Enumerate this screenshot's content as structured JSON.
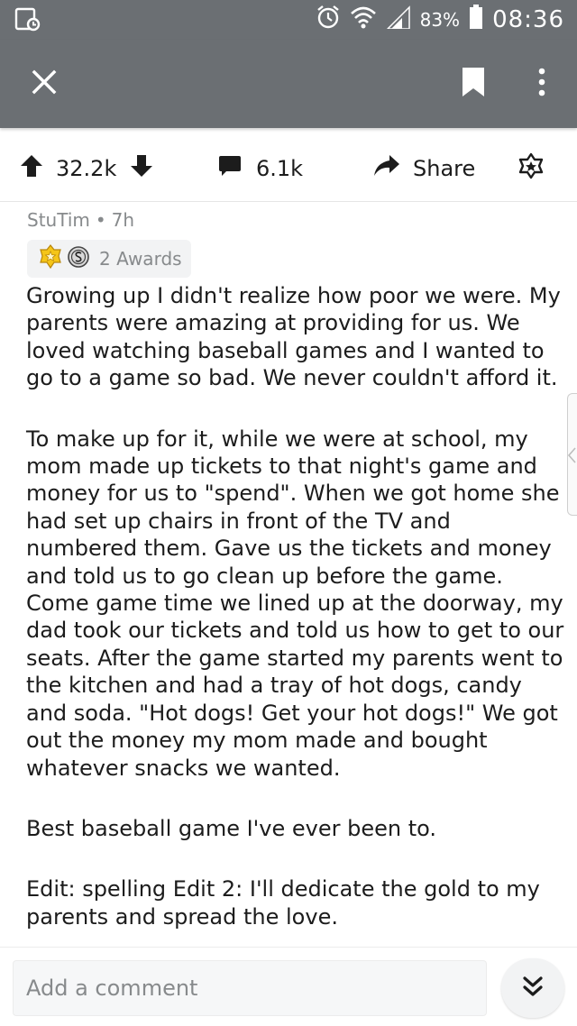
{
  "status_bar": {
    "battery_percent": "83%",
    "time": "08:36"
  },
  "action_bar": {
    "score": "32.2k",
    "comments_count": "6.1k",
    "share_label": "Share"
  },
  "post": {
    "author": "StuTim",
    "separator": "•",
    "age": "7h",
    "awards_label": "2 Awards",
    "paragraphs": [
      "Growing up I didn't realize how poor we were. My parents were amazing at providing for us. We loved watching baseball games and I wanted to go to a game so bad. We never couldn't afford it.",
      "To make up for it, while we were at school, my mom made up tickets to that night's game and money for us to \"spend\". When we got home she had set up chairs in front of the TV and numbered them. Gave us the tickets and money and told us to go clean up before the game. Come game time we lined up at the doorway, my dad took our tickets and told us how to get to our seats. After the game started my parents went to the kitchen and had a tray of hot dogs, candy and soda. \"Hot dogs! Get your hot dogs!\" We got out the money my mom made and bought whatever snacks we wanted.",
      "Best baseball game I've ever been to.",
      "Edit: spelling Edit 2: I'll dedicate the gold to my parents and spread the love."
    ]
  },
  "comment_bar": {
    "placeholder": "Add a comment"
  },
  "colors": {
    "app_bar": "#6b6f73",
    "meta_text": "#878a8c",
    "gold_award": "#f5c518"
  }
}
